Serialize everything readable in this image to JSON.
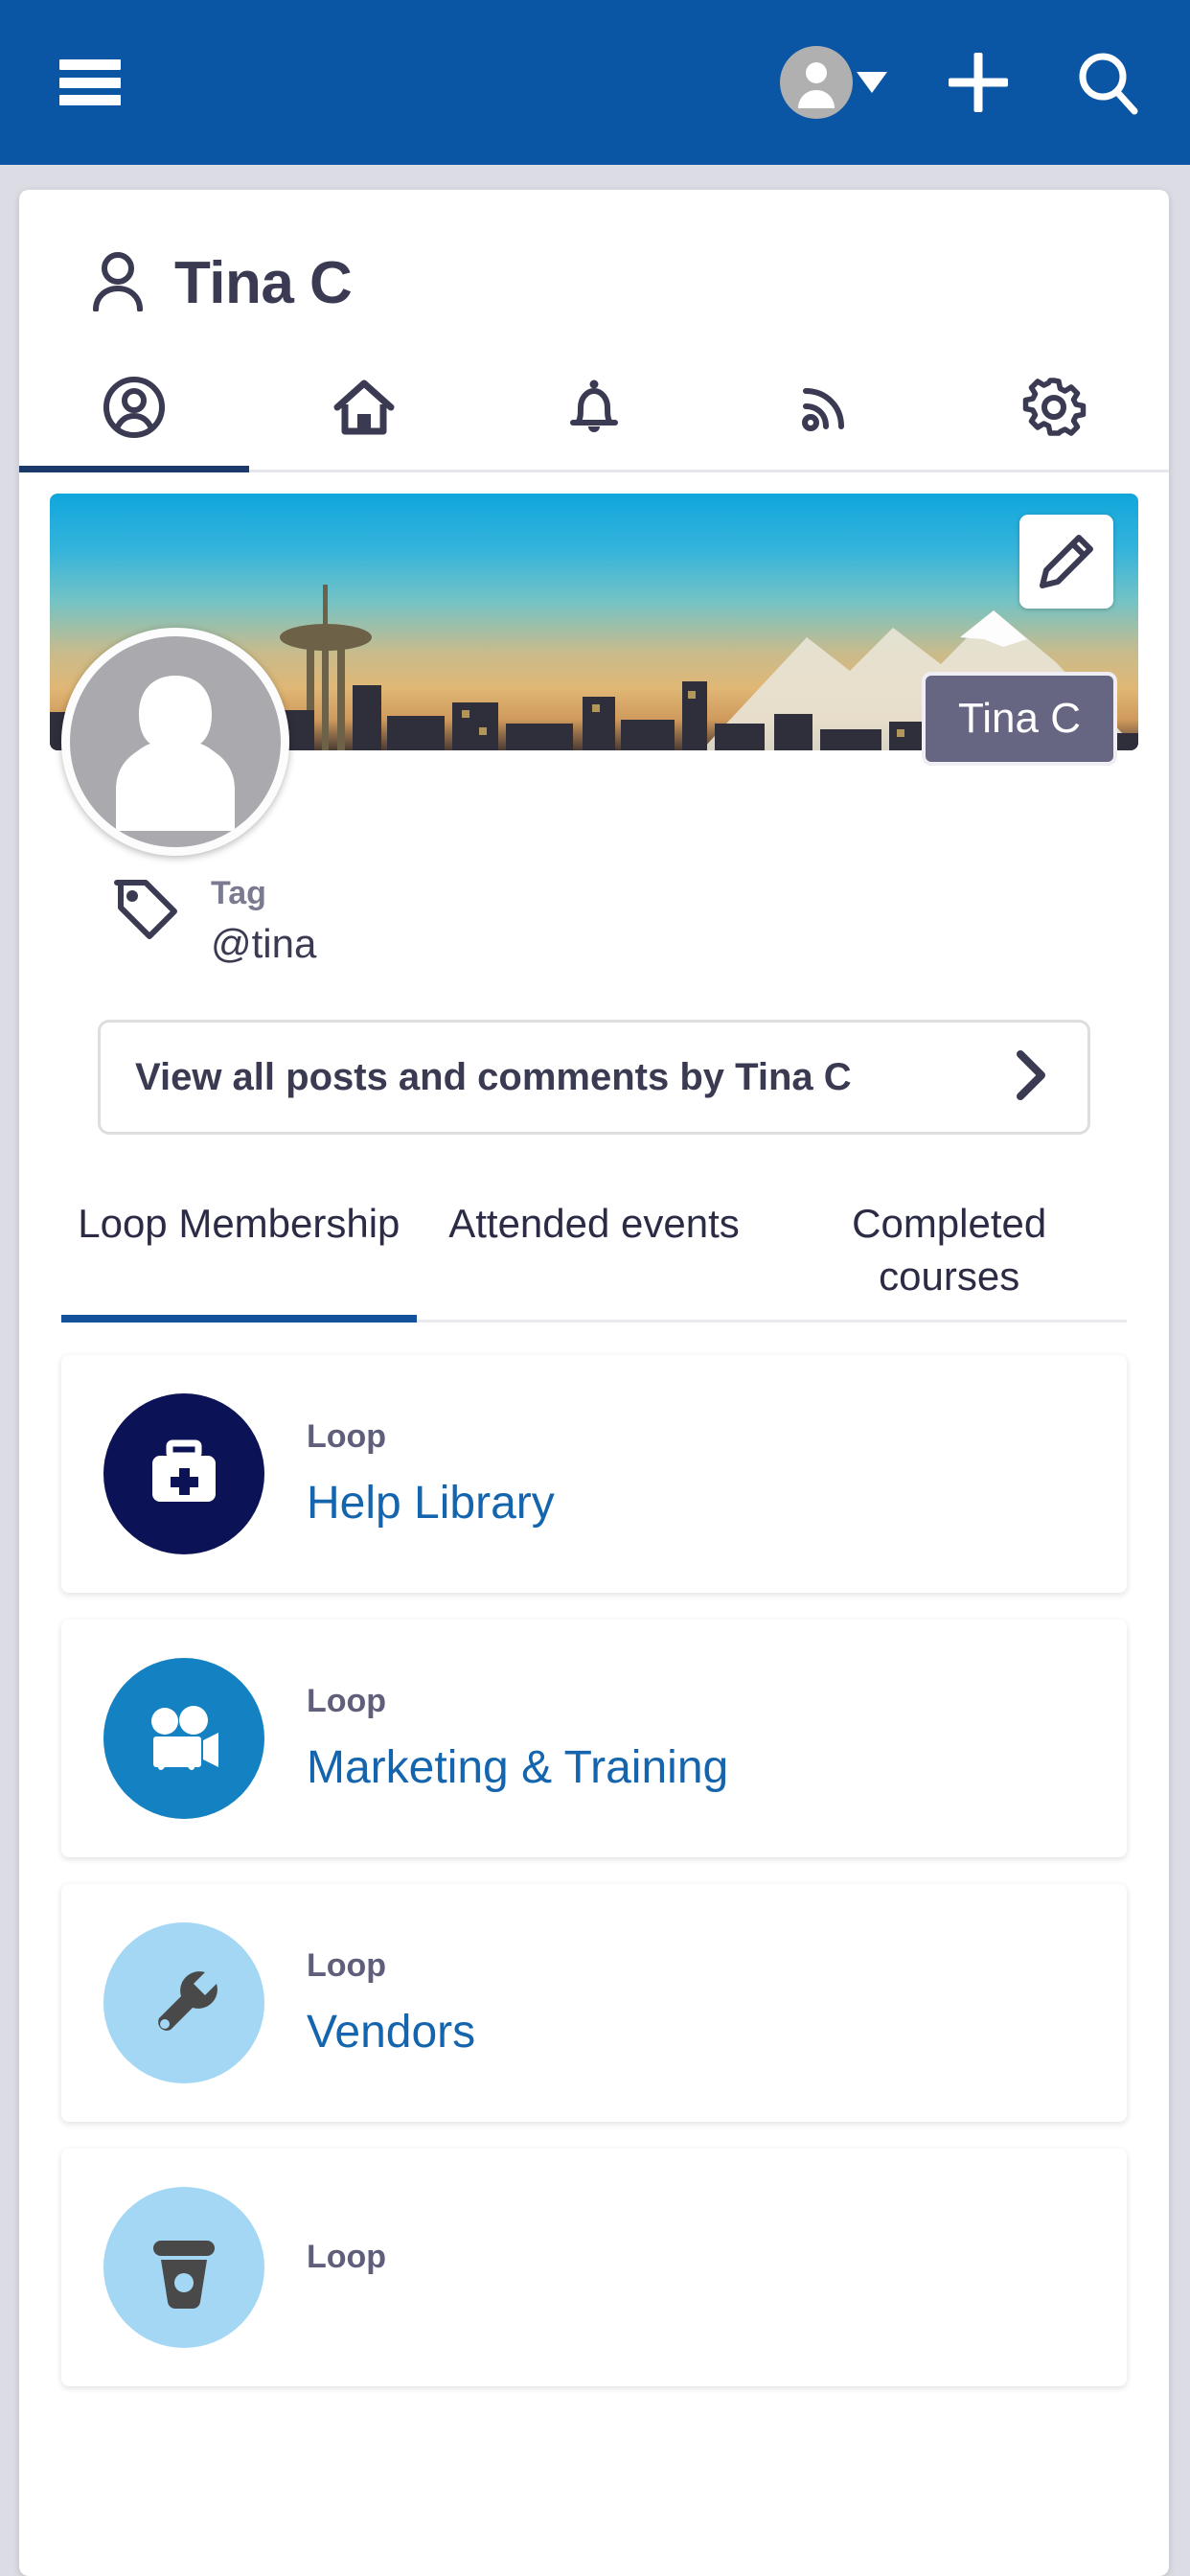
{
  "appbar": {
    "menu_icon": "hamburger-icon",
    "avatar_icon": "user-avatar-icon",
    "caret_icon": "caret-down-icon",
    "add_icon": "plus-icon",
    "search_icon": "search-icon",
    "bg_color": "#0a56a5"
  },
  "profile": {
    "name": "Tina C",
    "person_icon": "person-icon",
    "badge_name": "Tina C",
    "edit_icon": "pencil-icon",
    "avatar_icon": "female-avatar-icon"
  },
  "icon_tabs": [
    {
      "name": "profile",
      "icon": "account-circle-icon",
      "active": true
    },
    {
      "name": "home",
      "icon": "home-icon",
      "active": false
    },
    {
      "name": "notifications",
      "icon": "bell-icon",
      "active": false
    },
    {
      "name": "feed",
      "icon": "rss-icon",
      "active": false
    },
    {
      "name": "settings",
      "icon": "gear-icon",
      "active": false
    }
  ],
  "tag": {
    "icon": "tag-icon",
    "label": "Tag",
    "value": "@tina"
  },
  "view_all": {
    "label": "View all posts and comments by Tina C",
    "chevron_icon": "chevron-right-icon"
  },
  "subtabs": [
    {
      "label": "Loop Membership",
      "active": true
    },
    {
      "label": "Attended events",
      "active": false
    },
    {
      "label": "Completed courses",
      "active": false
    }
  ],
  "loops": [
    {
      "kind": "Loop",
      "name": "Help Library",
      "icon": "medical-briefcase-icon",
      "circle_color": "#0b1356",
      "glyph_color": "#ffffff"
    },
    {
      "kind": "Loop",
      "name": "Marketing & Training",
      "icon": "movie-camera-icon",
      "circle_color": "#1381c2",
      "glyph_color": "#ffffff"
    },
    {
      "kind": "Loop",
      "name": "Vendors",
      "icon": "wrench-icon",
      "circle_color": "#a3d7f4",
      "glyph_color": "#494949"
    },
    {
      "kind": "Loop",
      "name": "",
      "icon": "coffee-cup-icon",
      "circle_color": "#a3d7f4",
      "glyph_color": "#494949"
    }
  ],
  "colors": {
    "brand_blue": "#0a56a5",
    "link_blue": "#1565ae",
    "dark_navy": "#2b2b45",
    "active_underline": "#14519b"
  }
}
